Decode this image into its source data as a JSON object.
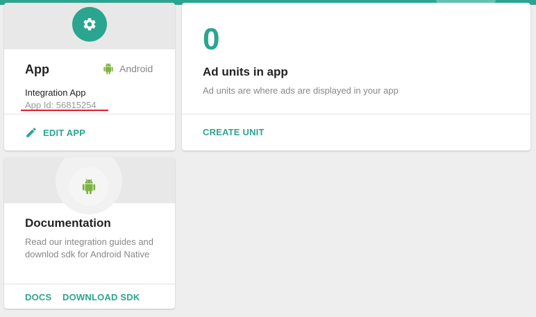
{
  "colors": {
    "accent": "#2aa58f",
    "android_green": "#7cb342",
    "underline_red": "#e01b2e"
  },
  "app_card": {
    "icon": "gear-icon",
    "title": "App",
    "platform_icon": "android-icon",
    "platform": "Android",
    "app_name": "Integration App",
    "app_id": "App Id: 56815254",
    "edit_icon": "pencil-icon",
    "edit_label": "EDIT APP"
  },
  "ad_card": {
    "count": "0",
    "title": "Ad units in app",
    "description": "Ad units are where ads are displayed in your app",
    "create_label": "CREATE UNIT"
  },
  "doc_card": {
    "icon": "android-icon",
    "title": "Documentation",
    "description": "Read our integration guides and downlod sdk for Android Native",
    "docs_label": "DOCS",
    "download_label": "DOWNLOAD SDK"
  }
}
